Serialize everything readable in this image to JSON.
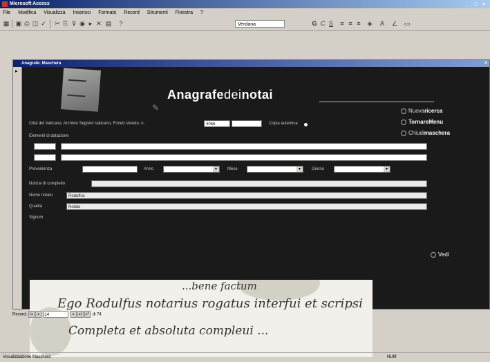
{
  "app": {
    "title": "Microsoft Access",
    "window_controls": "_ □ ×"
  },
  "menubar": {
    "items": [
      "File",
      "Modifica",
      "Visualizza",
      "Inserisci",
      "Formato",
      "Record",
      "Strumenti",
      "Finestra",
      "?"
    ]
  },
  "toolbar": {
    "font_name": "Verdana"
  },
  "child_window": {
    "title": "Anagrafe: Maschera"
  },
  "form": {
    "logo_caption": "",
    "title_bold": "Anagrafe",
    "title_light": "dei",
    "title_bold2": "notai",
    "subtitle": "",
    "nav": {
      "nuova_ricerca_prefix": "Nuova",
      "nuova_ricerca_bold": "ricerca",
      "tornare_menu_bold": "TornareMenu",
      "chiudi_prefix": "Chiudi",
      "chiudi_bold": "maschera"
    },
    "segnatura_label": "Città del Vaticano, Archivio Segreto Vaticano, Fondo Veneto, n.",
    "segnatura_value": "4066",
    "copia_label": "Copia autentica",
    "elementi_label": "Elementi di datazione",
    "row1_label": "",
    "row2_label": "",
    "qualita_label": "Qualità",
    "qualita_value": "Notaio",
    "provenienza_label": "Provenienza",
    "anno_label": "Anno",
    "mese_label": "Mese",
    "giorno_label": "Giorno",
    "sottoscrizione_label": "Notizia di completio",
    "sottoscrizione_value": "",
    "nome_label": "Nome notaio",
    "nome_value": "Rodulfus",
    "vedi_prefix": "Vedi",
    "vedi_bold": "",
    "signum_label": "Signum"
  },
  "manuscript": {
    "lines": [
      "...bene factum",
      "Ego Rodulfus notarius rogatus interfui et scripsi",
      "Completa et absoluta compleui ..."
    ]
  },
  "record_nav": {
    "label": "Record:",
    "current": "14",
    "total": "di 74"
  },
  "statusbar": {
    "left": "Visualizzazione Maschera",
    "right": "NUM"
  }
}
